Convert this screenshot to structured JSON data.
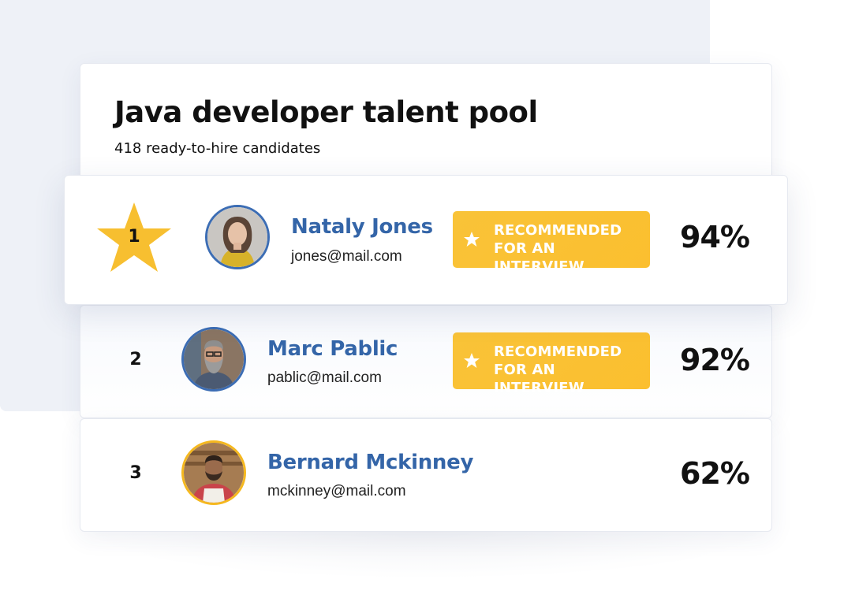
{
  "header": {
    "title": "Java developer talent pool",
    "subtitle": "418 ready-to-hire candidates"
  },
  "candidates": [
    {
      "rank": "1",
      "name": "Nataly Jones",
      "email": "jones@mail.com",
      "badge": "Recommended for an interview",
      "score": "94%",
      "top_pick": true,
      "avatar_icon": "person-portrait-woman-icon"
    },
    {
      "rank": "2",
      "name": "Marc Pablic",
      "email": "pablic@mail.com",
      "badge": "Recommended for an interview",
      "score": "92%",
      "avatar_icon": "person-portrait-man-beard-icon"
    },
    {
      "rank": "3",
      "name": "Bernard Mckinney",
      "email": "mckinney@mail.com",
      "score": "62%",
      "avatar_icon": "person-portrait-man-apron-icon"
    }
  ],
  "colors": {
    "accent": "#3465a8",
    "badge": "#fbbf2f",
    "panel_bg": "#eef1f7"
  }
}
